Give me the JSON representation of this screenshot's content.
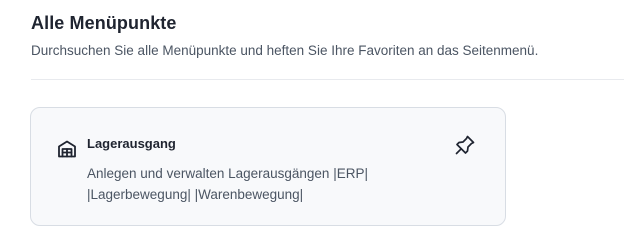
{
  "header": {
    "title": "Alle Menüpunkte",
    "subtitle": "Durchsuchen Sie alle Menüpunkte und heften Sie Ihre Favoriten an das Seitenmenü."
  },
  "menu_items": [
    {
      "title": "Lagerausgang",
      "description": "Anlegen und verwalten Lagerausgängen |ERP| |Lagerbewegung| |Warenbewegung|",
      "icon": "warehouse-icon",
      "pin_icon": "pin-icon"
    }
  ]
}
